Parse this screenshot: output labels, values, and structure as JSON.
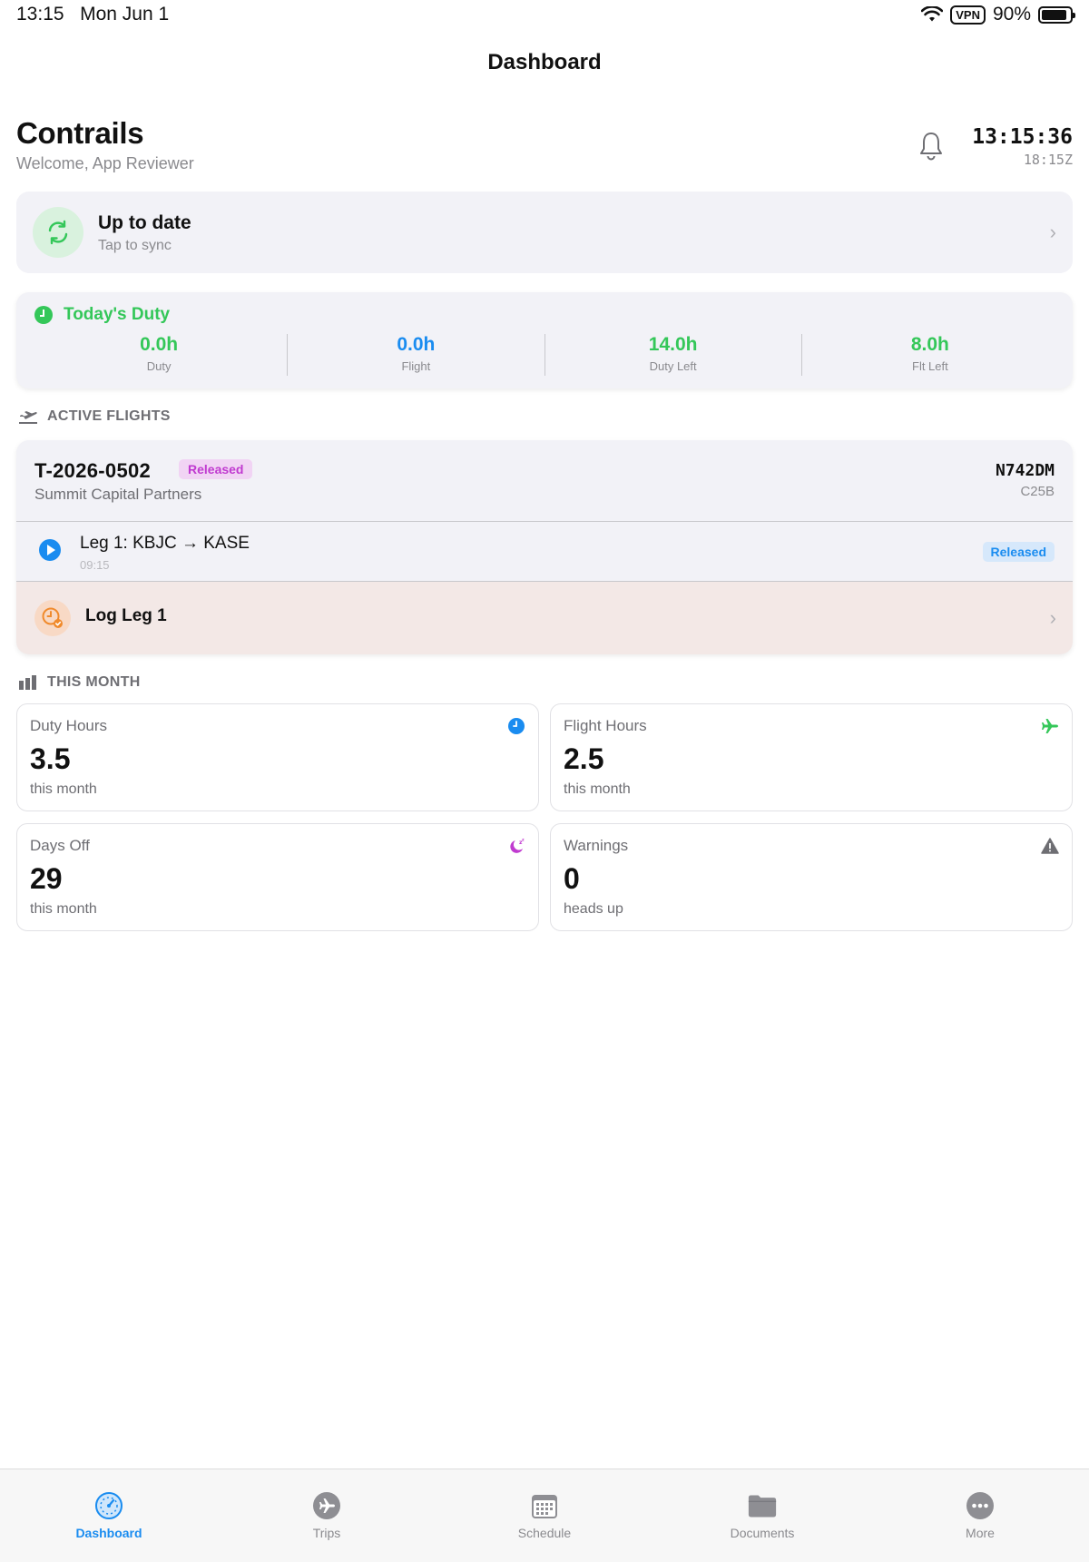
{
  "status_bar": {
    "time": "13:15",
    "date": "Mon Jun 1",
    "vpn": "VPN",
    "battery": "90%",
    "battery_level": 0.9
  },
  "nav": {
    "title": "Dashboard"
  },
  "header": {
    "app_name": "Contrails",
    "welcome": "Welcome, App Reviewer",
    "clock_local": "13:15:36",
    "clock_zulu": "18:15Z"
  },
  "sync": {
    "title": "Up to date",
    "subtitle": "Tap to sync"
  },
  "duty": {
    "title": "Today's Duty",
    "stats": [
      {
        "value": "0.0h",
        "label": "Duty",
        "color": "#34c759"
      },
      {
        "value": "0.0h",
        "label": "Flight",
        "color": "#1a8cf0"
      },
      {
        "value": "14.0h",
        "label": "Duty Left",
        "color": "#34c759"
      },
      {
        "value": "8.0h",
        "label": "Flt Left",
        "color": "#34c759"
      }
    ]
  },
  "active_flights": {
    "section_label": "ACTIVE FLIGHTS",
    "trip": {
      "id": "T-2026-0502",
      "status": "Released",
      "client": "Summit Capital Partners",
      "tail": "N742DM",
      "aircraft_type": "C25B"
    },
    "leg": {
      "title": "Leg 1: KBJC → KASE",
      "time": "09:15",
      "status": "Released"
    },
    "log_action": {
      "label": "Log Leg 1"
    }
  },
  "this_month": {
    "section_label": "THIS MONTH",
    "cards": [
      {
        "label": "Duty Hours",
        "value": "3.5",
        "sub": "this month",
        "icon": "clock-icon",
        "color": "#1a8cf0"
      },
      {
        "label": "Flight Hours",
        "value": "2.5",
        "sub": "this month",
        "icon": "airplane-icon",
        "color": "#34c759"
      },
      {
        "label": "Days Off",
        "value": "29",
        "sub": "this month",
        "icon": "moon-zzz-icon",
        "color": "#c03ad0"
      },
      {
        "label": "Warnings",
        "value": "0",
        "sub": "heads up",
        "icon": "warning-triangle-icon",
        "color": "#6e6e73"
      }
    ]
  },
  "tabbar": {
    "tabs": [
      {
        "label": "Dashboard",
        "icon": "dashboard-icon",
        "active": true
      },
      {
        "label": "Trips",
        "icon": "airplane-circle-icon"
      },
      {
        "label": "Schedule",
        "icon": "calendar-icon"
      },
      {
        "label": "Documents",
        "icon": "folder-icon"
      },
      {
        "label": "More",
        "icon": "more-icon"
      }
    ]
  },
  "colors": {
    "accent": "#1a8cf0",
    "green": "#34c759",
    "purple": "#c03ad0",
    "orange": "#f08a2c"
  }
}
